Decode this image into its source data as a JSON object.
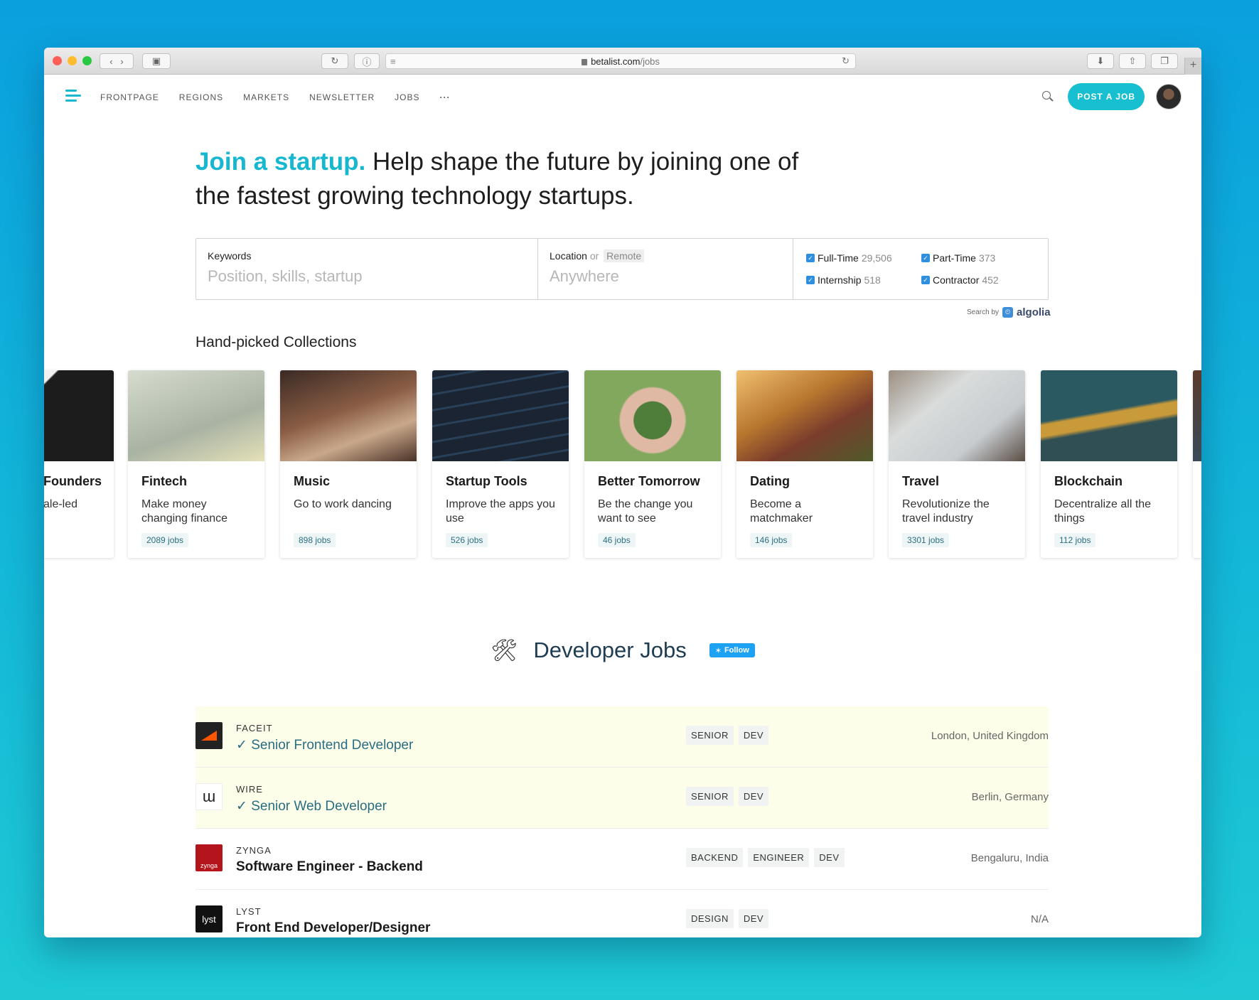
{
  "browser": {
    "url_domain": "betalist.com",
    "url_path": "/jobs"
  },
  "nav": {
    "links": [
      "FRONTPAGE",
      "REGIONS",
      "MARKETS",
      "NEWSLETTER",
      "JOBS",
      "···"
    ],
    "post_job": "POST A JOB"
  },
  "hero": {
    "accent": "Join a startup.",
    "rest": " Help shape the future by joining one of the fastest growing technology startups."
  },
  "search": {
    "keywords_label": "Keywords",
    "keywords_placeholder": "Position, skills, startup",
    "location_label": "Location",
    "or_text": "or",
    "remote_label": "Remote",
    "location_placeholder": "Anywhere",
    "filters": [
      {
        "label": "Full-Time",
        "count": "29,506"
      },
      {
        "label": "Part-Time",
        "count": "373"
      },
      {
        "label": "Internship",
        "count": "518"
      },
      {
        "label": "Contractor",
        "count": "452"
      }
    ],
    "search_by": "Search by",
    "search_by_brand": "algolia"
  },
  "collections": {
    "title": "Hand-picked Collections",
    "items": [
      {
        "name": "Founders",
        "desc": "ale-led",
        "count": "",
        "color": "#2a2a2a"
      },
      {
        "name": "Fintech",
        "desc": "Make money changing finance",
        "count": "2089 jobs",
        "color": "#c9cfc0"
      },
      {
        "name": "Music",
        "desc": "Go to work dancing",
        "count": "898 jobs",
        "color": "#6b4a3a"
      },
      {
        "name": "Startup Tools",
        "desc": "Improve the apps you use",
        "count": "526 jobs",
        "color": "#1f2b3a"
      },
      {
        "name": "Better Tomorrow",
        "desc": "Be the change you want to see",
        "count": "46 jobs",
        "color": "#5d8a4a"
      },
      {
        "name": "Dating",
        "desc": "Become a matchmaker",
        "count": "146 jobs",
        "color": "#a8703a"
      },
      {
        "name": "Travel",
        "desc": "Revolutionize the travel industry",
        "count": "3301 jobs",
        "color": "#bfc2c0"
      },
      {
        "name": "Blockchain",
        "desc": "Decentralize all the things",
        "count": "112 jobs",
        "color": "#2f5a62"
      }
    ]
  },
  "dev_jobs": {
    "icon": "🛠",
    "title": "Developer Jobs",
    "follow": "Follow",
    "jobs": [
      {
        "company": "FACEIT",
        "role": "✓ Senior Frontend Developer",
        "tags": [
          "SENIOR",
          "DEV"
        ],
        "location": "London, United Kingdom",
        "logo": "",
        "logo_bg": "#222222",
        "highlight": true
      },
      {
        "company": "WIRE",
        "role": "✓ Senior Web Developer",
        "tags": [
          "SENIOR",
          "DEV"
        ],
        "location": "Berlin, Germany",
        "logo": "ɯ",
        "logo_bg": "#ffffff",
        "highlight": true
      },
      {
        "company": "ZYNGA",
        "role": "Software Engineer - Backend",
        "tags": [
          "BACKEND",
          "ENGINEER",
          "DEV"
        ],
        "location": "Bengaluru, India",
        "logo": "zynga",
        "logo_bg": "#b4141b",
        "highlight": false
      },
      {
        "company": "LYST",
        "role": "Front End Developer/Designer",
        "tags": [
          "DESIGN",
          "DEV"
        ],
        "location": "N/A",
        "logo": "lyst",
        "logo_bg": "#111111",
        "highlight": false
      }
    ]
  }
}
